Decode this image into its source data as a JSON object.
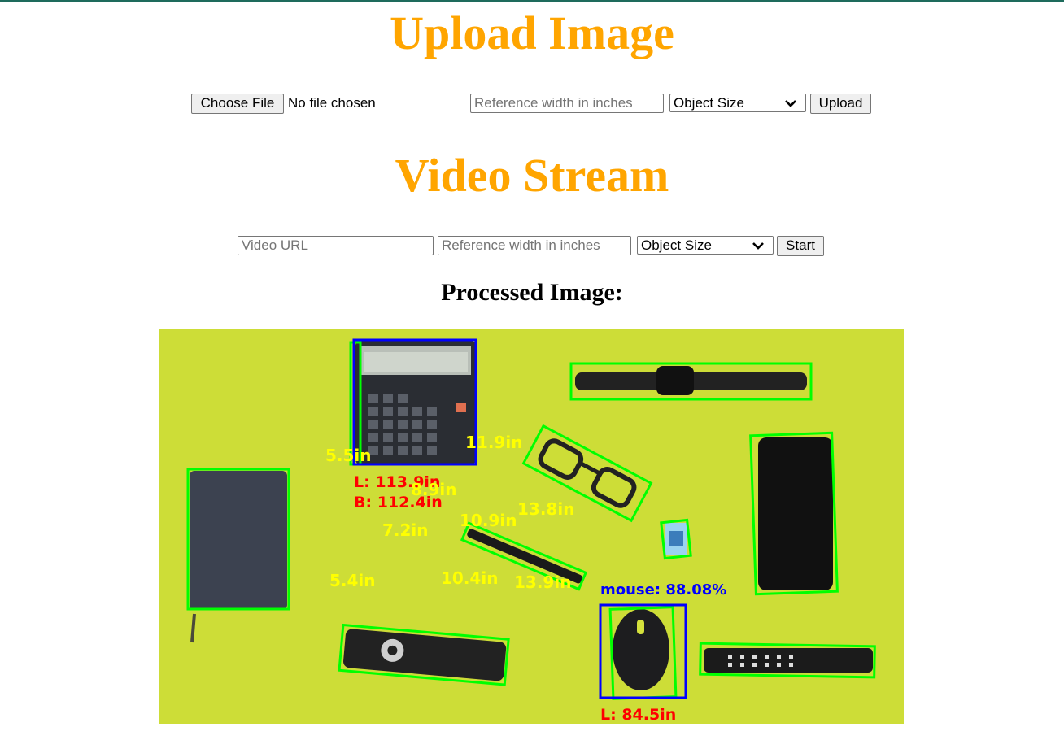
{
  "upload": {
    "title": "Upload Image",
    "choose_file_label": "Choose File",
    "file_status": "No file chosen",
    "ref_width_placeholder": "Reference width in inches",
    "mode_selected": "Object Size",
    "submit_label": "Upload"
  },
  "video": {
    "title": "Video Stream",
    "url_placeholder": "Video URL",
    "ref_width_placeholder": "Reference width in inches",
    "mode_selected": "Object Size",
    "submit_label": "Start"
  },
  "result": {
    "heading": "Processed Image:",
    "overlay_labels": {
      "calc_l": "L: 113.9in",
      "calc_b": "B: 112.4in",
      "calc_side": "5.5in",
      "glasses_top": "11.9in",
      "glasses_side": "13.8in",
      "calc_mid": "8.9in",
      "pen_top": "10.9in",
      "pen_left": "7.2in",
      "pen_mid": "10.4in",
      "pen_right": "13.9in",
      "notebook": "5.4in",
      "mouse_class": "mouse: 88.08%",
      "mouse_l": "L: 84.5in"
    },
    "colors": {
      "background": "#cddd37",
      "box_green": "#00ff00",
      "box_blue": "#0000ff",
      "text_yellow": "#ffff00",
      "text_red": "#ff0000"
    }
  }
}
